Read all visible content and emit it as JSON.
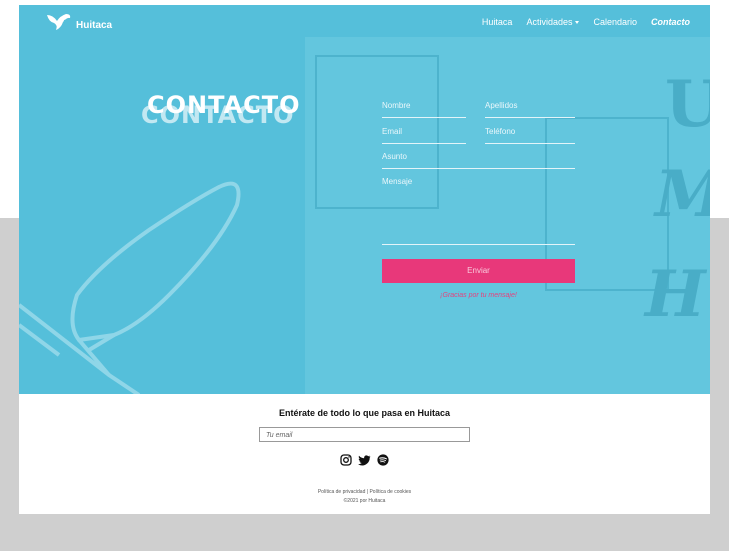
{
  "nav": {
    "logo_text": "Huitaca",
    "items": [
      "Huitaca",
      "Actividades",
      "Calendario",
      "Contacto"
    ]
  },
  "hero": {
    "title": "CONTACTO"
  },
  "form": {
    "nombre": "Nombre",
    "apellidos": "Apellidos",
    "email": "Email",
    "telefono": "Teléfono",
    "asunto": "Asunto",
    "mensaje": "Mensaje",
    "submit": "Enviar",
    "thanks": "¡Gracias por tu mensaje!"
  },
  "footer": {
    "newsletter_title": "Entérate de todo lo que pasa en Huitaca",
    "email_placeholder": "Tu email",
    "privacy": "Política de privacidad",
    "cookies": "Política de cookies",
    "copyright": "©2021 por Huitaca",
    "social_icons": [
      "instagram-icon",
      "twitter-icon",
      "spotify-icon"
    ]
  },
  "colors": {
    "hero_bg": "#55bfda",
    "accent": "#e8387a",
    "white": "#ffffff"
  }
}
